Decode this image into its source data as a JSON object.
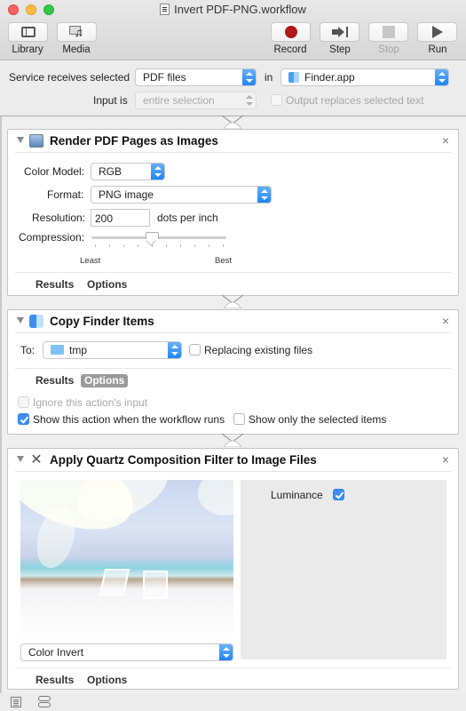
{
  "window": {
    "title": "Invert PDF-PNG.workflow"
  },
  "toolbar": {
    "library": {
      "label": "Library",
      "icon": "library-icon"
    },
    "media": {
      "label": "Media",
      "icon": "media-icon"
    },
    "record": {
      "label": "Record",
      "icon": "record-icon",
      "color": "#b0191a"
    },
    "step": {
      "label": "Step",
      "icon": "step-icon"
    },
    "stop": {
      "label": "Stop",
      "icon": "stop-icon",
      "disabled": true
    },
    "run": {
      "label": "Run",
      "icon": "run-icon"
    }
  },
  "service": {
    "receives_label": "Service receives selected",
    "receives_value": "PDF files",
    "in_label": "in",
    "app_value": "Finder.app",
    "input_is_label": "Input is",
    "input_is_value": "entire selection",
    "output_replaces_label": "Output replaces selected text",
    "output_replaces_checked": false
  },
  "actions": [
    {
      "title": "Render PDF Pages as Images",
      "icon": "render-pdf-icon",
      "color_model_label": "Color Model:",
      "color_model_value": "RGB",
      "format_label": "Format:",
      "format_value": "PNG image",
      "resolution_label": "Resolution:",
      "resolution_value": "200",
      "resolution_unit": "dots per inch",
      "compression_label": "Compression:",
      "compression_min_label": "Least",
      "compression_max_label": "Best",
      "compression_ticks": 10,
      "compression_level": 0.44,
      "tabs": [
        "Results",
        "Options"
      ],
      "active_tab": null
    },
    {
      "title": "Copy Finder Items",
      "icon": "finder-icon",
      "to_label": "To:",
      "to_value": "tmp",
      "replacing_label": "Replacing existing files",
      "replacing_checked": false,
      "tabs": [
        "Results",
        "Options"
      ],
      "active_tab": "Options",
      "options": {
        "ignore_input_label": "Ignore this action's input",
        "ignore_input_checked": false,
        "ignore_input_disabled": true,
        "show_action_label": "Show this action when the workflow runs",
        "show_action_checked": true,
        "show_selected_label": "Show only the selected items",
        "show_selected_checked": false
      }
    },
    {
      "title": "Apply Quartz Composition Filter to Image Files",
      "icon": "quartz-filter-icon",
      "filter_value": "Color Invert",
      "luminance_label": "Luminance",
      "luminance_checked": true,
      "tabs": [
        "Results",
        "Options"
      ],
      "active_tab": null
    }
  ],
  "statusbar": {
    "log_icon": "log-view-icon",
    "variables_icon": "variables-view-icon"
  }
}
